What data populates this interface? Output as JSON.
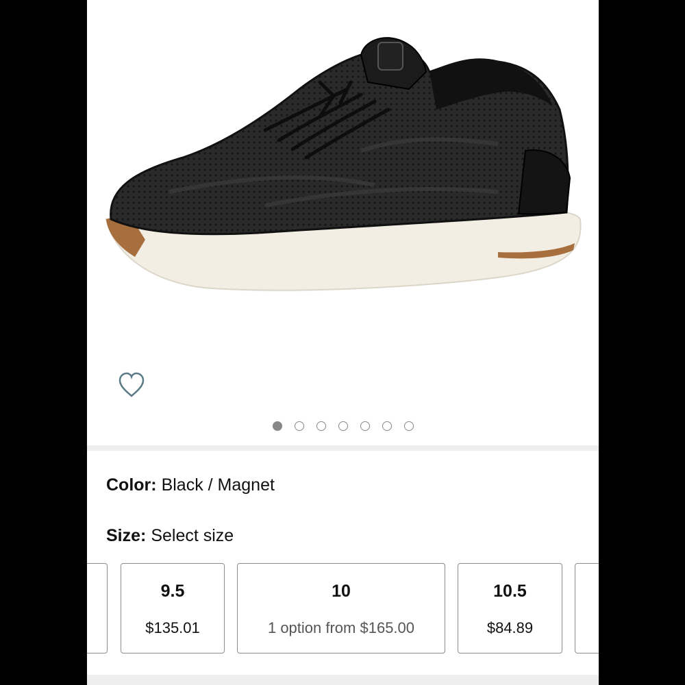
{
  "product": {
    "image_count": 7,
    "active_image_index": 0,
    "colors": {
      "sole": "#f2eee4",
      "gum": "#a86f3e",
      "upper": "#262626"
    }
  },
  "color": {
    "label": "Color:",
    "value": "Black / Magnet"
  },
  "size": {
    "label": "Size:",
    "value": "Select size"
  },
  "size_options": [
    {
      "size": "",
      "price": ""
    },
    {
      "size": "9.5",
      "price": "$135.01"
    },
    {
      "size": "10",
      "price": "1 option from $165.00"
    },
    {
      "size": "10.5",
      "price": "$84.89"
    },
    {
      "size": "",
      "price": ""
    }
  ]
}
